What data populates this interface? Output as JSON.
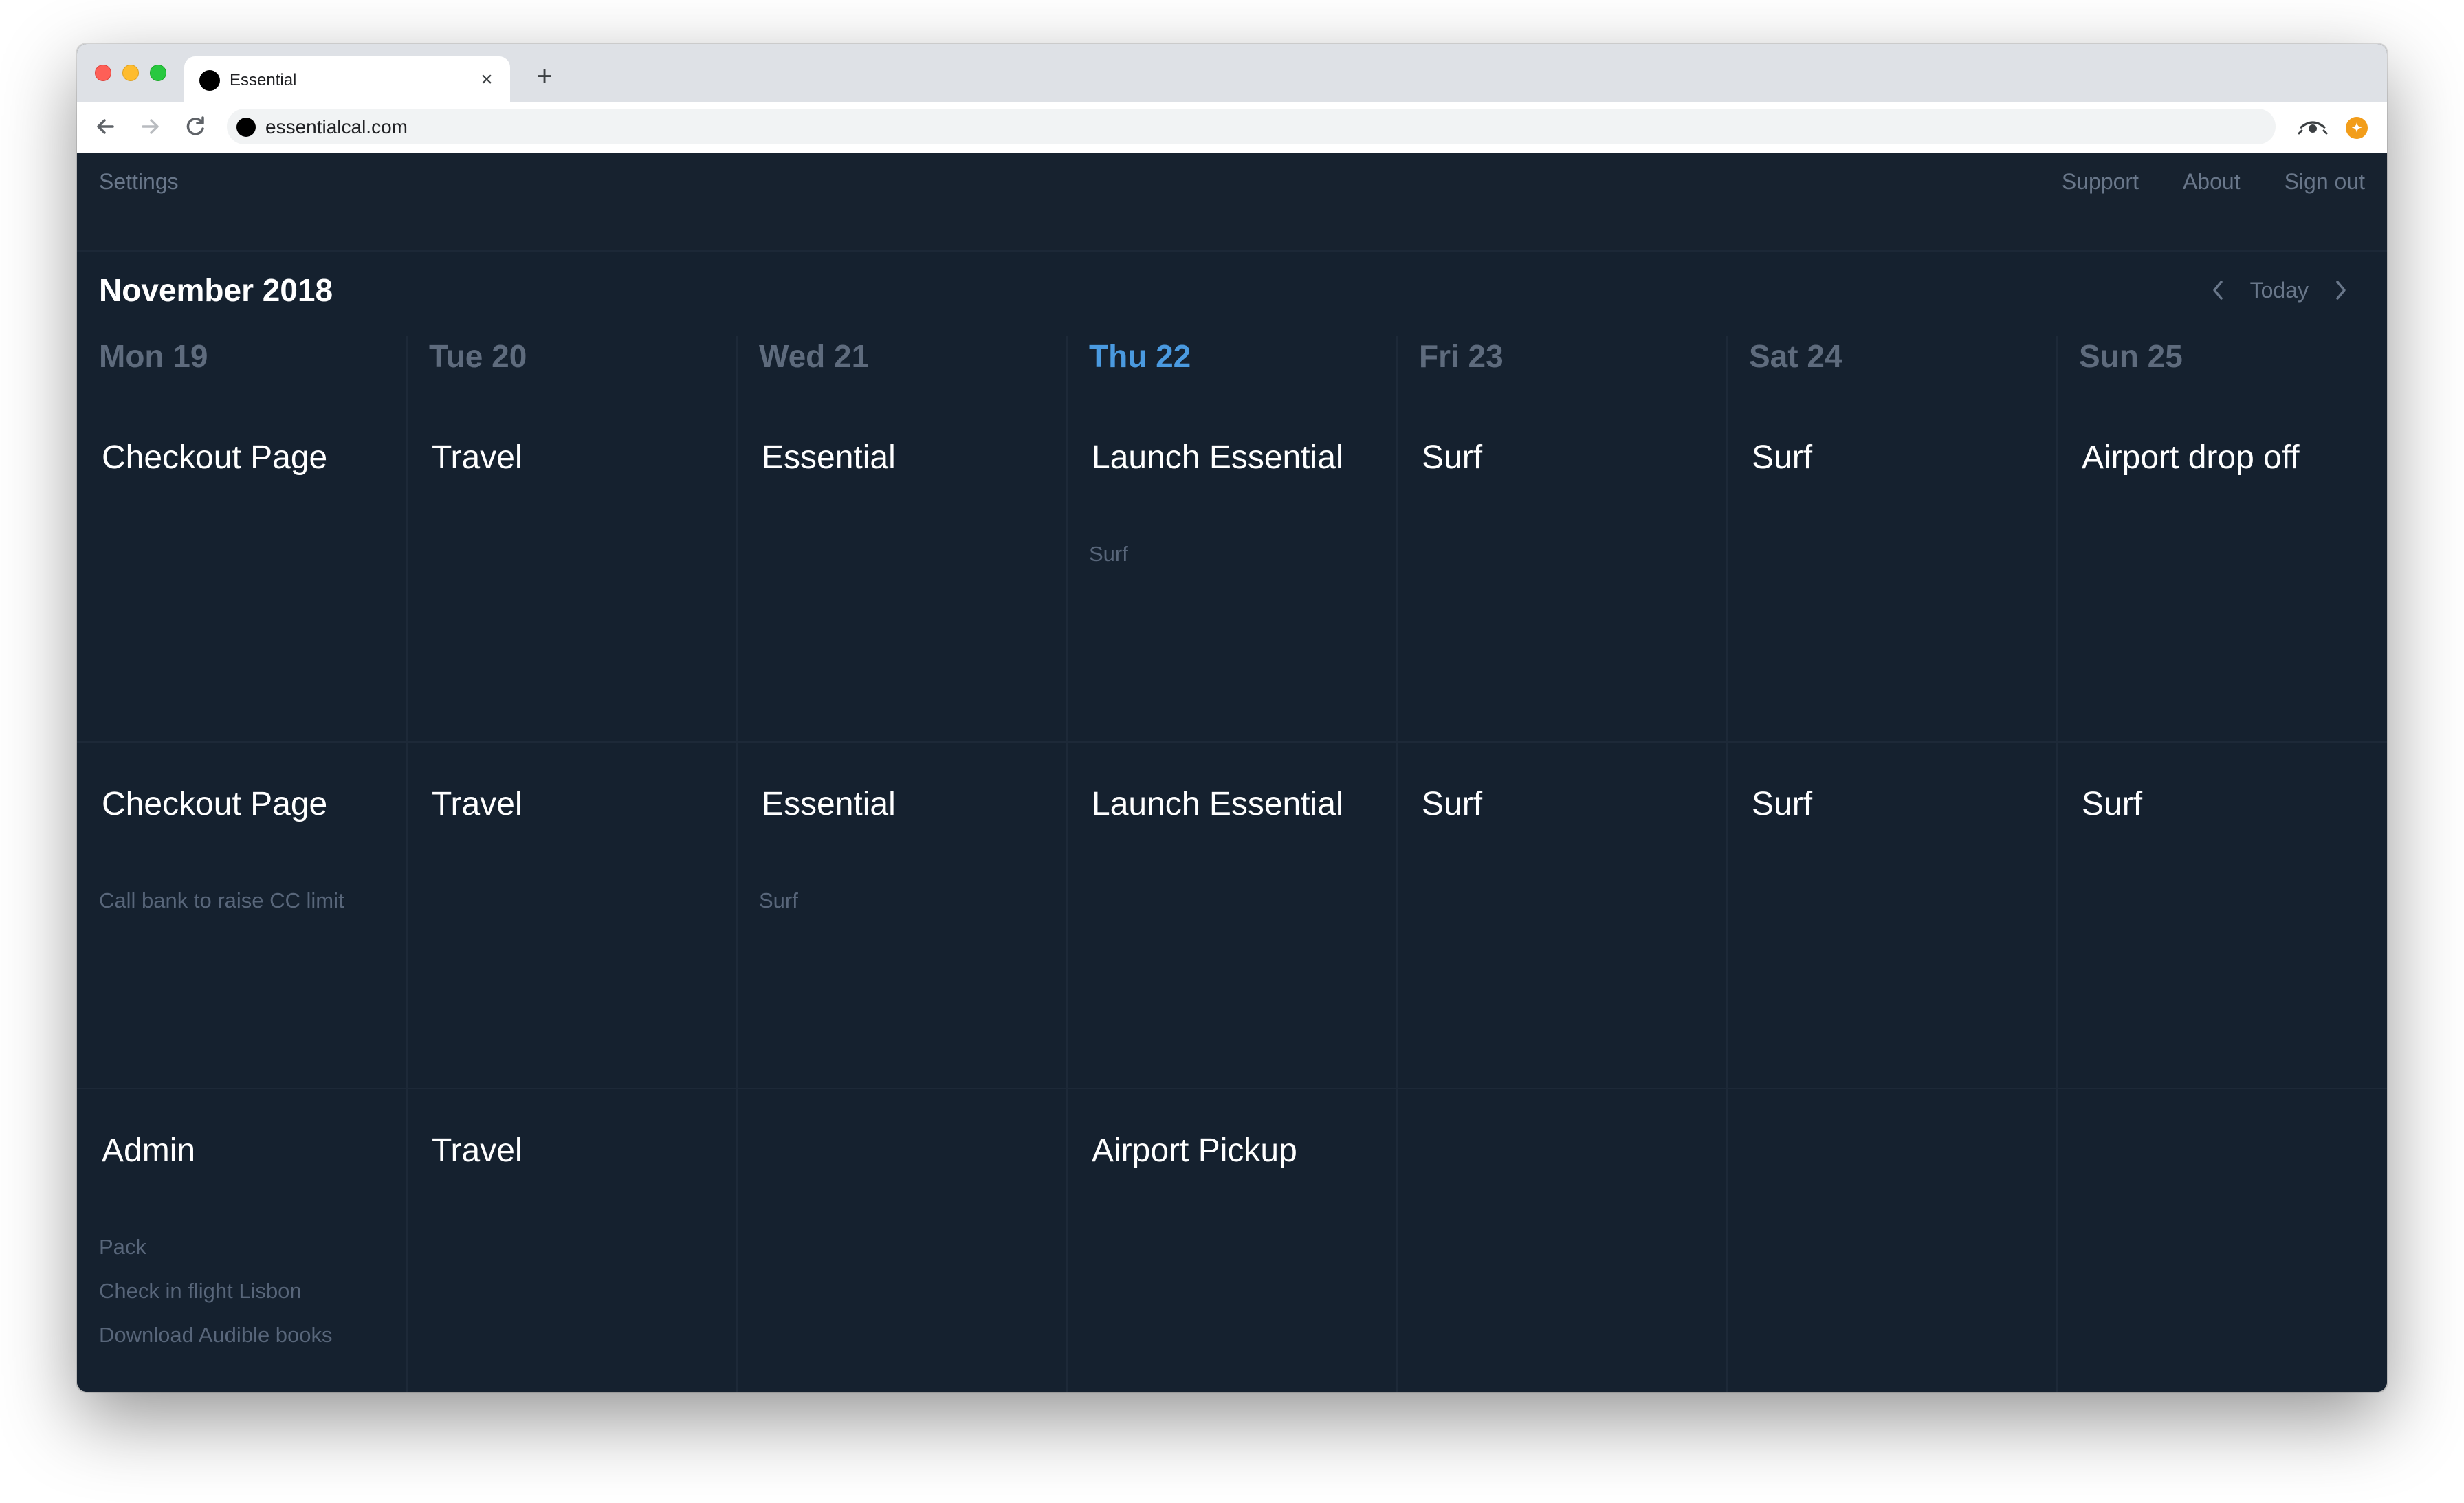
{
  "browser": {
    "tab_title": "Essential",
    "tab_close": "×",
    "new_tab": "+",
    "url": "essentialcal.com",
    "ext_badge": "✦"
  },
  "appnav": {
    "settings": "Settings",
    "support": "Support",
    "about": "About",
    "sign_out": "Sign out"
  },
  "calendar": {
    "month_title": "November 2018",
    "today_label": "Today",
    "today_color": "#4a9ae0",
    "days": [
      {
        "label": "Mon 19",
        "is_today": false
      },
      {
        "label": "Tue 20",
        "is_today": false
      },
      {
        "label": "Wed 21",
        "is_today": false
      },
      {
        "label": "Thu 22",
        "is_today": true
      },
      {
        "label": "Fri 23",
        "is_today": false
      },
      {
        "label": "Sat 24",
        "is_today": false
      },
      {
        "label": "Sun 25",
        "is_today": false
      }
    ],
    "rows": [
      [
        {
          "title": "Checkout Page",
          "tasks": []
        },
        {
          "title": "Travel",
          "tasks": []
        },
        {
          "title": "Essential",
          "tasks": []
        },
        {
          "title": "Launch Essential",
          "tasks": [
            "Surf"
          ]
        },
        {
          "title": "Surf",
          "tasks": []
        },
        {
          "title": "Surf",
          "tasks": []
        },
        {
          "title": "Airport drop off",
          "tasks": []
        }
      ],
      [
        {
          "title": "Checkout Page",
          "tasks": [
            "Call bank to raise CC limit"
          ]
        },
        {
          "title": "Travel",
          "tasks": []
        },
        {
          "title": "Essential",
          "tasks": [
            "Surf"
          ]
        },
        {
          "title": "Launch Essential",
          "tasks": []
        },
        {
          "title": "Surf",
          "tasks": []
        },
        {
          "title": "Surf",
          "tasks": []
        },
        {
          "title": "Surf",
          "tasks": []
        }
      ],
      [
        {
          "title": "Admin",
          "tasks": [
            "Pack",
            "Check in flight Lisbon",
            "Download Audible books"
          ]
        },
        {
          "title": "Travel",
          "tasks": []
        },
        {
          "title": "",
          "tasks": []
        },
        {
          "title": "Airport Pickup",
          "tasks": []
        },
        {
          "title": "",
          "tasks": []
        },
        {
          "title": "",
          "tasks": []
        },
        {
          "title": "",
          "tasks": []
        }
      ]
    ]
  },
  "icons": {
    "back": "arrow-left-icon",
    "forward": "arrow-right-icon",
    "reload": "reload-icon",
    "prev": "chevron-left-icon",
    "next": "chevron-right-icon"
  }
}
